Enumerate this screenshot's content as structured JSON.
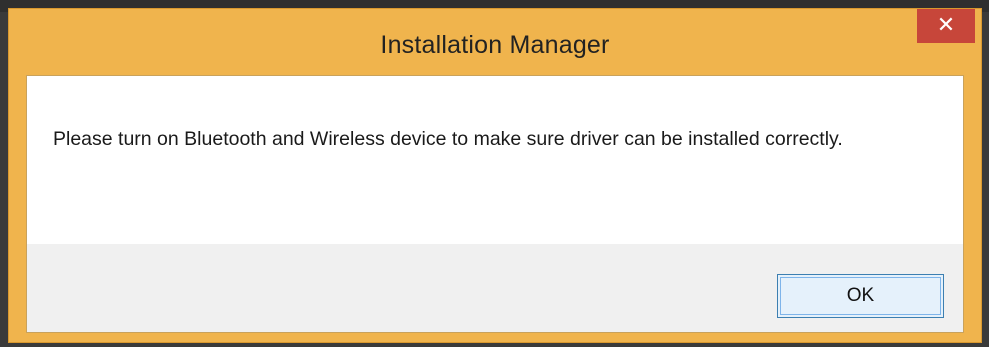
{
  "window": {
    "title": "Installation Manager",
    "close_symbol": "✕",
    "close_icon": "close-icon"
  },
  "dialog": {
    "message": "Please turn on Bluetooth and Wireless device to make sure driver can be installed correctly.",
    "ok_label": "OK"
  },
  "colors": {
    "titlebar": "#f0b44d",
    "close_button": "#c7463a",
    "client_bg": "#ffffff",
    "footer_bg": "#f0f0f0",
    "button_border": "#3c7fb1"
  }
}
